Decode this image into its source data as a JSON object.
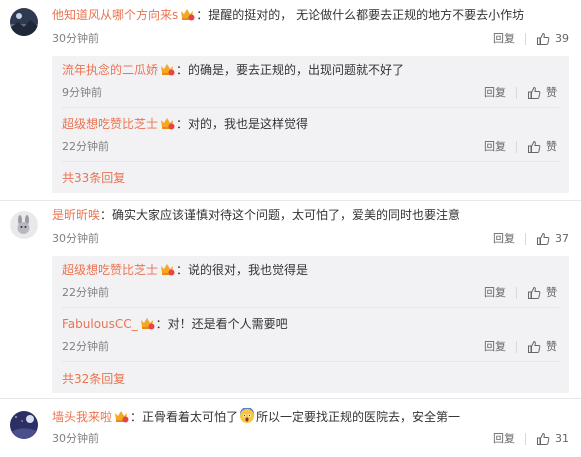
{
  "colors": {
    "username": "#eb7350",
    "text": "#333333",
    "meta": "#808080",
    "reply_bg": "#f2f2f5"
  },
  "icons": {
    "vip_badge": "vip-crown-badge-icon",
    "like": "thumbs-up-icon",
    "scared_emoji": "scared-face-emoji-icon"
  },
  "comments": [
    {
      "username": "他知道风从哪个方向来s",
      "text": "：提醒的挺对的， 无论做什么都要去正规的地方不要去小作坊",
      "time": "30分钟前",
      "reply_label": "回复",
      "likes": "39",
      "replies": [
        {
          "username": "流年执念的二瓜娇",
          "text": "：的确是，要去正规的，出现问题就不好了",
          "time": "9分钟前",
          "reply_label": "回复",
          "like_label": "赞"
        },
        {
          "username": "超级想吃赞比芝士",
          "text": "：对的，我也是这样觉得",
          "time": "22分钟前",
          "reply_label": "回复",
          "like_label": "赞"
        }
      ],
      "more_label": "共33条回复"
    },
    {
      "username": "是昕昕唉",
      "text": "：确实大家应该谨慎对待这个问题，太可怕了，爱美的同时也要注意",
      "time": "30分钟前",
      "reply_label": "回复",
      "likes": "37",
      "replies": [
        {
          "username": "超级想吃赞比芝士",
          "text": "：说的很对，我也觉得是",
          "time": "22分钟前",
          "reply_label": "回复",
          "like_label": "赞"
        },
        {
          "username": "FabulousCC_",
          "text": "：对！还是看个人需要吧",
          "time": "22分钟前",
          "reply_label": "回复",
          "like_label": "赞"
        }
      ],
      "more_label": "共32条回复"
    },
    {
      "username": "墙头我来啦",
      "text_before": "：正骨看着太可怕了",
      "text_after": "所以一定要找正规的医院去，安全第一",
      "time": "30分钟前",
      "reply_label": "回复",
      "likes": "31"
    }
  ]
}
